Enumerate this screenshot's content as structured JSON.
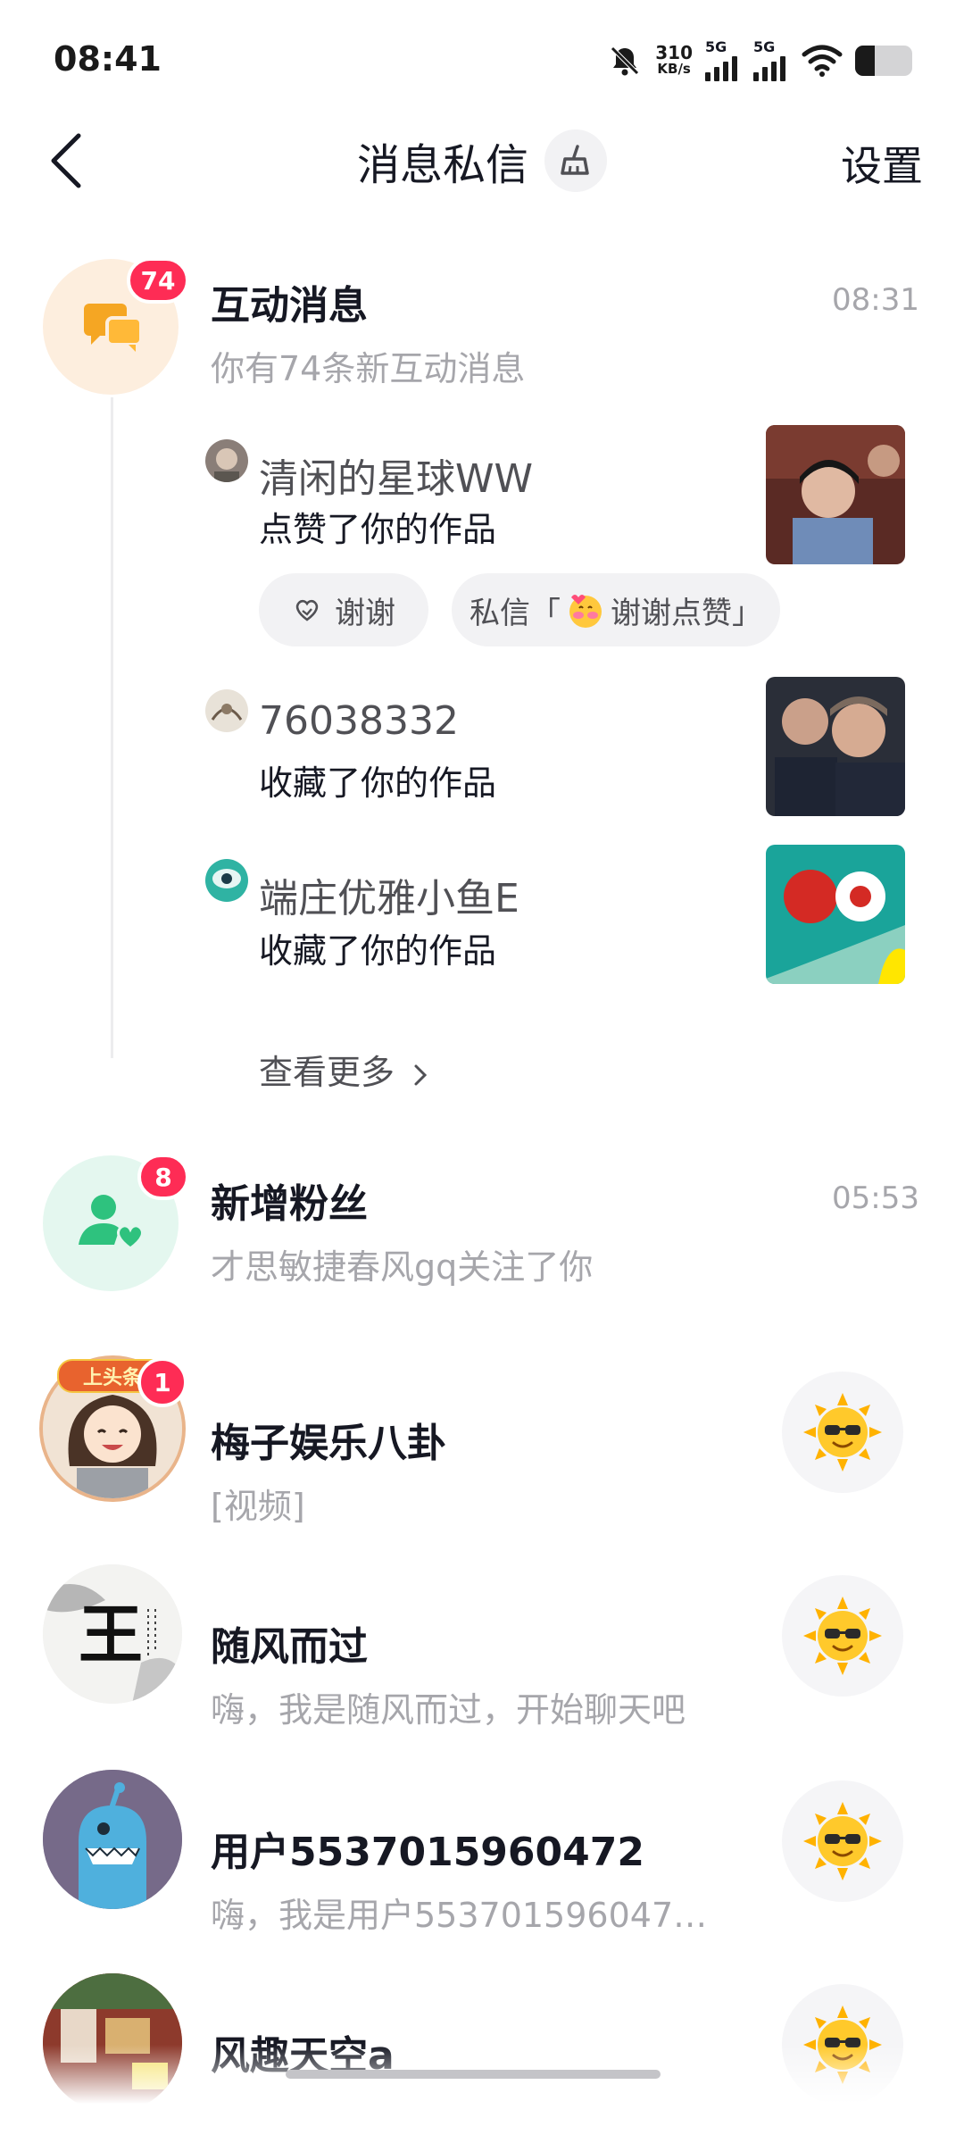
{
  "status": {
    "time": "08:41",
    "speed_value": "310",
    "speed_unit": "KB/s",
    "sim1": "5G",
    "sim2": "5G",
    "battery_level": 0.35
  },
  "header": {
    "title": "消息私信",
    "settings": "设置"
  },
  "interactions": {
    "title": "互动消息",
    "subtitle": "你有74条新互动消息",
    "time": "08:31",
    "badge": "74",
    "items": [
      {
        "name": "清闲的星球WW",
        "action": "点赞了你的作品"
      },
      {
        "name": "76038332",
        "action": "收藏了你的作品"
      },
      {
        "name": "端庄优雅小鱼E",
        "action": "收藏了你的作品"
      }
    ],
    "thanks_label": "谢谢",
    "dm_prefix": "私信「",
    "dm_text": "谢谢点赞」",
    "see_more": "查看更多"
  },
  "fans": {
    "title": "新增粉丝",
    "subtitle": "才思敏捷春风gq关注了你",
    "time": "05:53",
    "badge": "8"
  },
  "chats": [
    {
      "name": "梅子娱乐八卦",
      "preview": "[视频]",
      "badge": "1",
      "banner": "上头条"
    },
    {
      "name": "随风而过",
      "preview": "嗨，我是随风而过，开始聊天吧",
      "glyph": "王"
    },
    {
      "name": "用户5537015960472",
      "preview": "嗨，我是用户553701596047…"
    },
    {
      "name": "风趣天空a",
      "preview": ""
    }
  ],
  "colors": {
    "badge": "#fe2c55",
    "interaction_bg": "#fdeede",
    "interaction_icon": "#f5a623",
    "fans_bg": "#e4f7ef",
    "fans_icon": "#2ec27e"
  }
}
